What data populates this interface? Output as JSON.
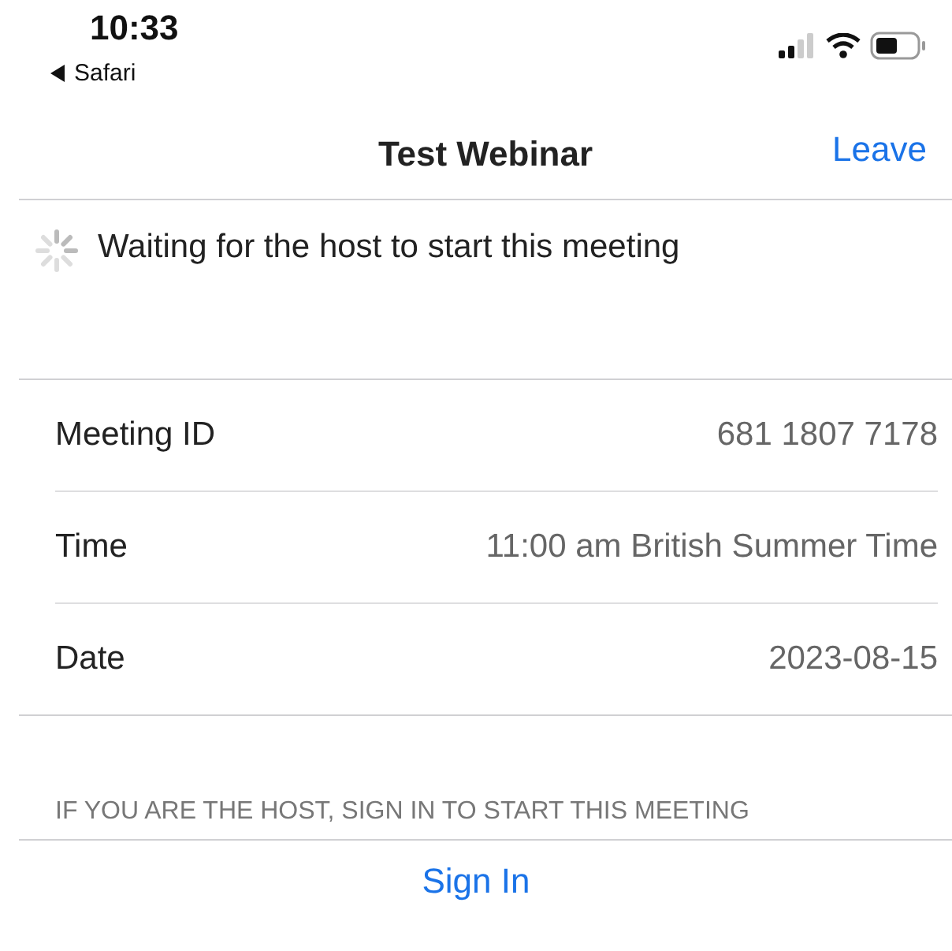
{
  "status_bar": {
    "time": "10:33",
    "back_label": "Safari"
  },
  "nav": {
    "title": "Test Webinar",
    "action": "Leave"
  },
  "waiting": {
    "message": "Waiting for the host to start this meeting"
  },
  "details": [
    {
      "label": "Meeting ID",
      "value": "681 1807 7178"
    },
    {
      "label": "Time",
      "value": "11:00 am British Summer Time"
    },
    {
      "label": "Date",
      "value": "2023-08-15"
    }
  ],
  "host_note": "IF YOU ARE THE HOST, SIGN IN TO START THIS MEETING",
  "sign_in": "Sign In"
}
